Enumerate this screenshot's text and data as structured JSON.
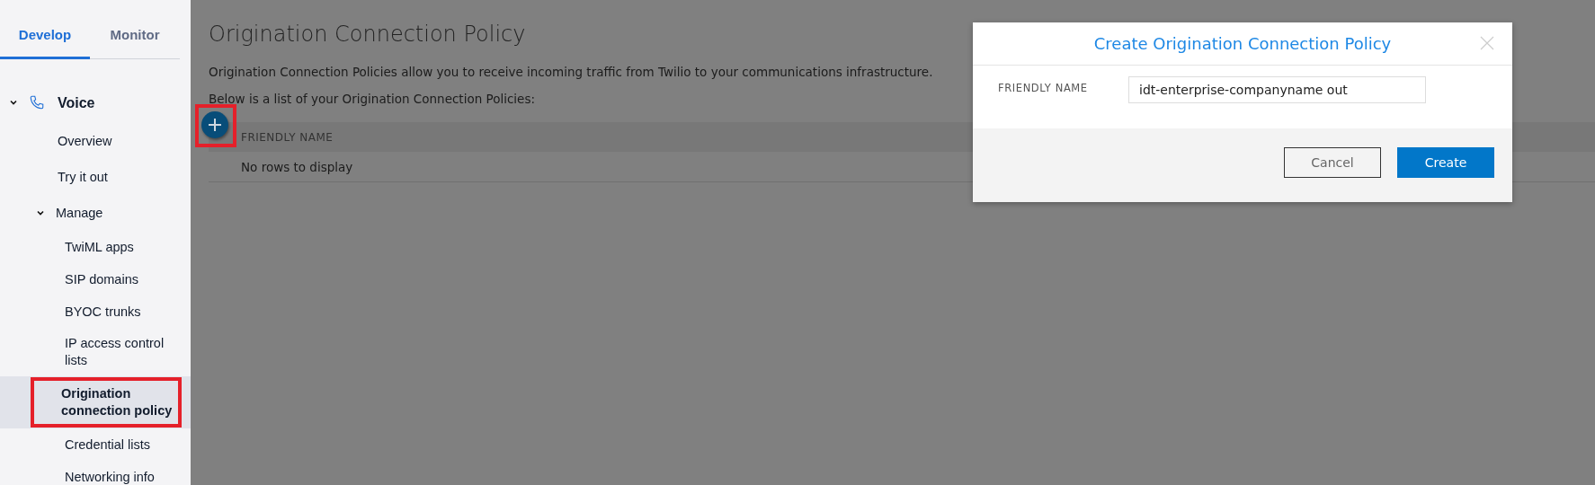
{
  "sidebar": {
    "tabs": [
      {
        "label": "Develop",
        "selected": true
      },
      {
        "label": "Monitor",
        "selected": false
      }
    ],
    "nav": [
      {
        "label": "Voice",
        "expanded": true,
        "selected": false,
        "children": [
          {
            "label": "Overview",
            "selected": false
          },
          {
            "label": "Try it out",
            "selected": false
          },
          {
            "label": "Manage",
            "expanded": true,
            "selected": false,
            "children": [
              {
                "label": "TwiML apps",
                "selected": false
              },
              {
                "label": "SIP domains",
                "selected": false
              },
              {
                "label": "BYOC trunks",
                "selected": false
              },
              {
                "label": "IP access control lists",
                "selected": false
              },
              {
                "label": "Origination connection policy",
                "selected": true
              },
              {
                "label": "Credential lists",
                "selected": false
              },
              {
                "label": "Networking info",
                "selected": false
              }
            ]
          }
        ]
      }
    ]
  },
  "page": {
    "title": "Origination Connection Policy",
    "description": "Origination Connection Policies allow you to receive incoming traffic from Twilio to your communications infrastructure.",
    "list_intro": "Below is a list of your Origination Connection Policies:",
    "table": {
      "columns": [
        "FRIENDLY NAME"
      ],
      "empty_text": "No rows to display"
    }
  },
  "dialog": {
    "title": "Create Origination Connection Policy",
    "fields": [
      {
        "label": "FRIENDLY NAME",
        "value": "idt-enterprise-companyname out"
      }
    ],
    "buttons": [
      {
        "label": "Cancel",
        "kind": "secondary"
      },
      {
        "label": "Create",
        "kind": "primary"
      }
    ]
  }
}
